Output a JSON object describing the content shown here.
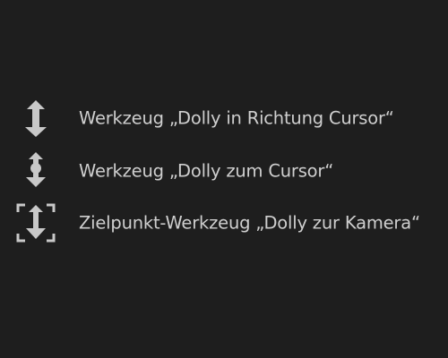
{
  "tools": [
    {
      "icon": "dolly-to-cursor-arrow-icon",
      "label": "Werkzeug „Dolly in Richtung Cursor“"
    },
    {
      "icon": "dolly-with-cursor-icon",
      "label": "Werkzeug „Dolly zum Cursor“"
    },
    {
      "icon": "dolly-to-camera-target-icon",
      "label": "Zielpunkt-Werkzeug „Dolly zur Kamera“"
    }
  ],
  "colors": {
    "background": "#1e1e1e",
    "text": "#cfcfcf",
    "icon": "#c8c8c8"
  }
}
